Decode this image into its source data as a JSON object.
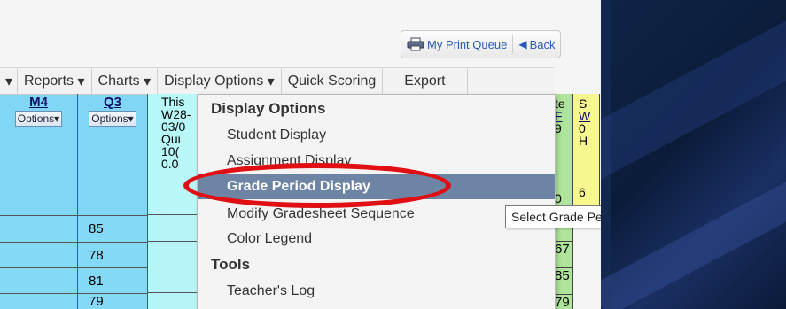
{
  "toolbar": {
    "print_queue_label": "My Print Queue",
    "print_icon": "printer-icon",
    "back_label": "Back",
    "back_icon": "left-triangle-icon"
  },
  "menubar": {
    "items": [
      "Reports",
      "Charts",
      "Display Options",
      "Quick Scoring",
      "Export"
    ],
    "caret": "▾"
  },
  "columns": [
    {
      "name": "M4",
      "options_label": "Options",
      "values": []
    },
    {
      "name": "Q3",
      "options_label": "Options",
      "values": [
        "85",
        "78",
        "81",
        "79"
      ]
    }
  ],
  "this_column": {
    "lines": [
      "This",
      "W28-",
      "03/0",
      "Qui",
      "10(",
      "0.0"
    ]
  },
  "right_columns": {
    "col1_head": [
      "te",
      "F",
      "9",
      "0"
    ],
    "col1_values": [
      "67",
      "85",
      "79"
    ],
    "col2_head": [
      "S",
      "W",
      "0",
      "H",
      "",
      "6"
    ]
  },
  "dropdown": {
    "section1": "Display Options",
    "items1": [
      "Student Display",
      "Assignment Display",
      "Grade Period Display",
      "Modify Gradesheet Sequence",
      "Color Legend"
    ],
    "highlighted": "Grade Period Display",
    "section2": "Tools",
    "items2": [
      "Teacher's Log"
    ]
  },
  "tooltip": "Select Grade Period Display Options",
  "colors": {
    "highlight": "#6d84a4",
    "annotation_ring": "#e00f13",
    "grade_cell": "#84daf6"
  }
}
